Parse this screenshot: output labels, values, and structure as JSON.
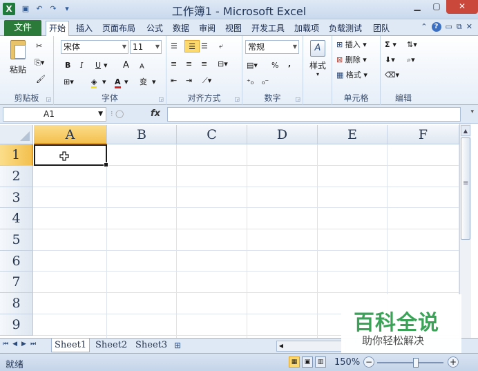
{
  "window": {
    "title": "工作簿1 - Microsoft Excel",
    "app_icon": "X",
    "qat": [
      "save-icon",
      "undo-icon",
      "redo-icon",
      "customize-icon"
    ],
    "controls": [
      "minimize-icon",
      "maximize-icon",
      "close-icon"
    ]
  },
  "ribbon_tabs": {
    "file": "文件",
    "tabs": [
      "开始",
      "插入",
      "页面布局",
      "公式",
      "数据",
      "审阅",
      "视图",
      "开发工具",
      "加载项",
      "负载测试",
      "团队"
    ],
    "active": "开始"
  },
  "clipboard": {
    "paste": "粘贴",
    "label": "剪贴板"
  },
  "font": {
    "name": "宋体",
    "size": "11",
    "label": "字体",
    "bold": "B",
    "italic": "I",
    "underline": "U",
    "grow": "A",
    "shrink": "A",
    "wen": "变"
  },
  "alignment": {
    "label": "对齐方式"
  },
  "number": {
    "format": "常规",
    "percent": "%",
    "comma": ",",
    "label": "数字"
  },
  "styles": {
    "label": "样式"
  },
  "cells": {
    "insert": "插入",
    "delete": "删除",
    "format": "格式",
    "label": "单元格"
  },
  "editing": {
    "sum": "Σ",
    "label": "编辑"
  },
  "formula_bar": {
    "name_box": "A1",
    "fx": "fx",
    "formula": ""
  },
  "columns": [
    "A",
    "B",
    "C",
    "D",
    "E",
    "F"
  ],
  "rows": [
    "1",
    "2",
    "3",
    "4",
    "5",
    "6",
    "7",
    "8",
    "9"
  ],
  "selected_cell": "A1",
  "sheets": [
    "Sheet1",
    "Sheet2",
    "Sheet3"
  ],
  "active_sheet": "Sheet1",
  "status": {
    "ready": "就绪",
    "zoom": "150%"
  },
  "watermark": {
    "title": "百科全说",
    "subtitle": "助你轻松解决"
  },
  "colors": {
    "accent": "#2b7a3a",
    "selection": "#f3c04e",
    "watermark": "#3aa357"
  }
}
